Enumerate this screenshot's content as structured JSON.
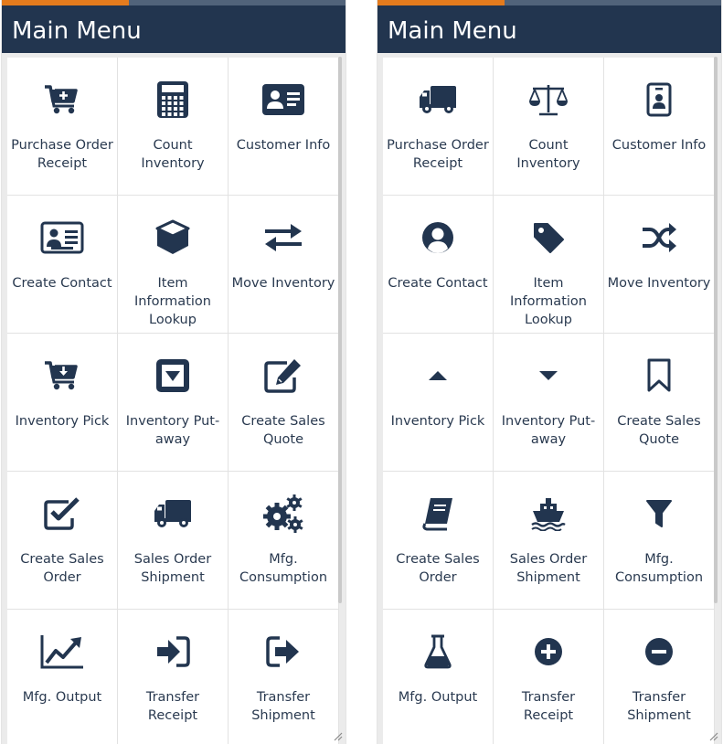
{
  "panels": [
    {
      "title": "Main Menu",
      "items": [
        {
          "label": "Purchase Order Receipt",
          "icon": "cart-plus-icon"
        },
        {
          "label": "Count Inventory",
          "icon": "calculator-icon"
        },
        {
          "label": "Customer Info",
          "icon": "id-card-icon"
        },
        {
          "label": "Create Contact",
          "icon": "contact-card-icon"
        },
        {
          "label": "Item Information Lookup",
          "icon": "cube-icon"
        },
        {
          "label": "Move Inventory",
          "icon": "exchange-arrows-icon"
        },
        {
          "label": "Inventory Pick",
          "icon": "cart-arrow-down-icon"
        },
        {
          "label": "Inventory Put-away",
          "icon": "caret-square-down-icon"
        },
        {
          "label": "Create Sales Quote",
          "icon": "edit-icon"
        },
        {
          "label": "Create Sales Order",
          "icon": "check-square-icon"
        },
        {
          "label": "Sales Order Shipment",
          "icon": "truck-icon"
        },
        {
          "label": "Mfg. Consumption",
          "icon": "gears-icon"
        },
        {
          "label": "Mfg. Output",
          "icon": "line-chart-icon"
        },
        {
          "label": "Transfer Receipt",
          "icon": "sign-in-icon"
        },
        {
          "label": "Transfer Shipment",
          "icon": "share-square-icon"
        }
      ]
    },
    {
      "title": "Main Menu",
      "items": [
        {
          "label": "Purchase Order Receipt",
          "icon": "truck-icon"
        },
        {
          "label": "Count Inventory",
          "icon": "balance-scale-icon"
        },
        {
          "label": "Customer Info",
          "icon": "id-badge-icon"
        },
        {
          "label": "Create Contact",
          "icon": "user-circle-icon"
        },
        {
          "label": "Item Information Lookup",
          "icon": "tag-icon"
        },
        {
          "label": "Move Inventory",
          "icon": "random-icon"
        },
        {
          "label": "Inventory Pick",
          "icon": "caret-up-icon"
        },
        {
          "label": "Inventory Put-away",
          "icon": "caret-down-icon"
        },
        {
          "label": "Create Sales Quote",
          "icon": "bookmark-icon"
        },
        {
          "label": "Create Sales Order",
          "icon": "book-icon"
        },
        {
          "label": "Sales Order Shipment",
          "icon": "ship-icon"
        },
        {
          "label": "Mfg. Consumption",
          "icon": "filter-icon"
        },
        {
          "label": "Mfg. Output",
          "icon": "flask-icon"
        },
        {
          "label": "Transfer Receipt",
          "icon": "plus-circle-icon"
        },
        {
          "label": "Transfer Shipment",
          "icon": "minus-circle-icon"
        }
      ]
    }
  ],
  "colors": {
    "header": "#22354f",
    "accent": "#e47b1d",
    "accent_track": "#51637a",
    "icon": "#22354f",
    "text": "#2a3a50"
  }
}
